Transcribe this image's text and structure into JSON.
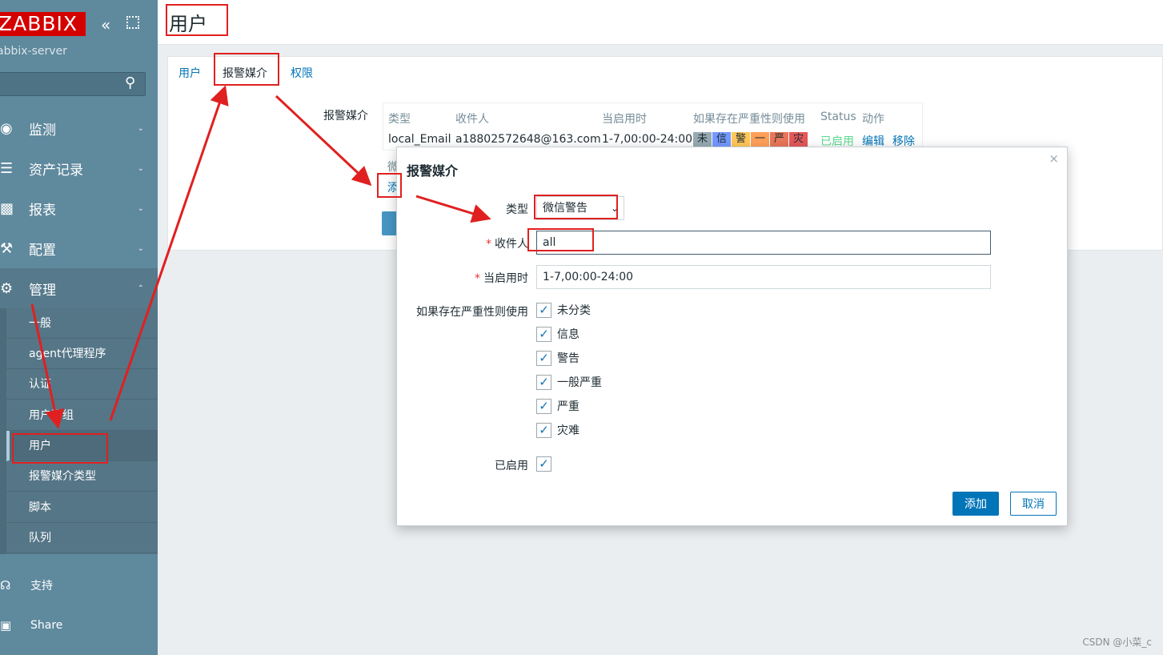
{
  "sidebar": {
    "logo": "ZABBIX",
    "server": "abbix-server",
    "nav": [
      {
        "icon": "eye-icon",
        "label": "监测"
      },
      {
        "icon": "list-icon",
        "label": "资产记录"
      },
      {
        "icon": "bar-chart-icon",
        "label": "报表"
      },
      {
        "icon": "wrench-icon",
        "label": "配置"
      },
      {
        "icon": "gear-icon",
        "label": "管理"
      }
    ],
    "submenu": [
      "一般",
      "agent代理程序",
      "认证",
      "用户群组",
      "用户",
      "报警媒介类型",
      "脚本",
      "队列"
    ],
    "active_submenu": "用户",
    "bottom": [
      {
        "icon": "headset-icon",
        "label": "支持"
      },
      {
        "icon": "share-icon",
        "label": "Share"
      }
    ]
  },
  "page": {
    "title": "用户",
    "tabs": [
      "用户",
      "报警媒介",
      "权限"
    ],
    "active_tab": "报警媒介",
    "media_label": "报警媒介",
    "media_table": {
      "headers": [
        "类型",
        "收件人",
        "当启用时",
        "如果存在严重性则使用",
        "Status",
        "动作"
      ],
      "row": {
        "type": "local_Email",
        "sendto": "a18802572648@163.com",
        "when_active": "1-7,00:00-24:00",
        "severities": [
          "未",
          "信",
          "警",
          "一",
          "严",
          "灾"
        ],
        "status": "已启用",
        "actions": [
          "编辑",
          "移除"
        ]
      }
    },
    "stub_sub": "微",
    "stub_add": "添"
  },
  "modal": {
    "title": "报警媒介",
    "close": "×",
    "type_label": "类型",
    "type_value": "微信警告",
    "sendto_label": "收件人",
    "sendto_value": "all",
    "period_label": "当启用时",
    "period_value": "1-7,00:00-24:00",
    "severity_label": "如果存在严重性则使用",
    "severities": [
      "未分类",
      "信息",
      "警告",
      "一般严重",
      "严重",
      "灾难"
    ],
    "enabled_label": "已启用",
    "add_button": "添加",
    "cancel_button": "取消"
  },
  "colors": {
    "sidebar": "#5f899d",
    "accent": "#0275b8",
    "logo": "#d40000",
    "annotation": "#e02020",
    "sev_not_classified": "#97aab3",
    "sev_info": "#7499ff",
    "sev_warning": "#ffc859",
    "sev_average": "#ffa059",
    "sev_high": "#e97659",
    "sev_disaster": "#e45959"
  },
  "watermark": "CSDN @小菜_c"
}
